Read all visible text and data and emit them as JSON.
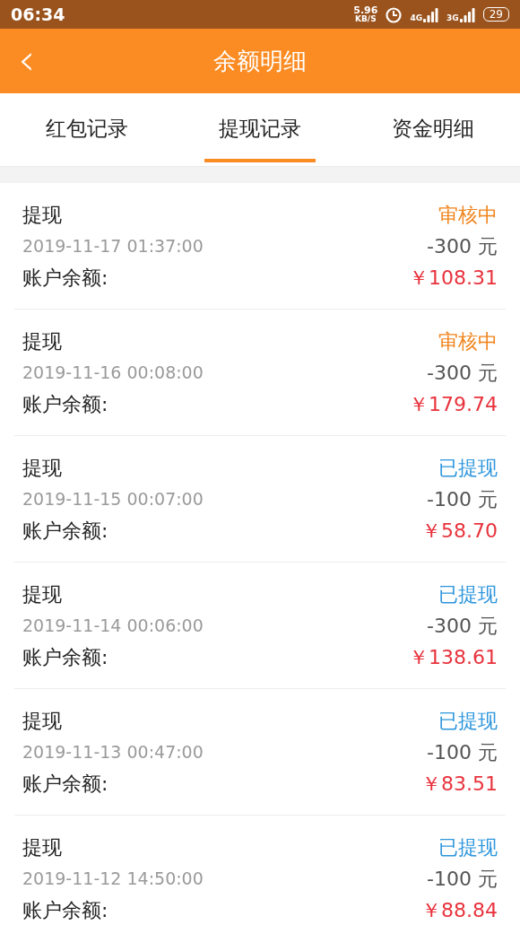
{
  "status_bar": {
    "time": "06:34",
    "speed": "5.96",
    "speed_unit": "KB/S",
    "network_1": "4G",
    "network_2": "3G",
    "battery": "29"
  },
  "header": {
    "back": "‹",
    "title": "余额明细"
  },
  "tabs": [
    {
      "label": "红包记录",
      "selected": false
    },
    {
      "label": "提现记录",
      "selected": true
    },
    {
      "label": "资金明细",
      "selected": false
    }
  ],
  "records": [
    {
      "title": "提现",
      "date": "2019-11-17 01:37:00",
      "balance_label": "账户余额:",
      "status": "审核中",
      "kind": "pending",
      "amount": "-300 元",
      "balance": "￥108.31"
    },
    {
      "title": "提现",
      "date": "2019-11-16 00:08:00",
      "balance_label": "账户余额:",
      "status": "审核中",
      "kind": "pending",
      "amount": "-300 元",
      "balance": "￥179.74"
    },
    {
      "title": "提现",
      "date": "2019-11-15 00:07:00",
      "balance_label": "账户余额:",
      "status": "已提现",
      "kind": "done",
      "amount": "-100 元",
      "balance": "￥58.70"
    },
    {
      "title": "提现",
      "date": "2019-11-14 00:06:00",
      "balance_label": "账户余额:",
      "status": "已提现",
      "kind": "done",
      "amount": "-300 元",
      "balance": "￥138.61"
    },
    {
      "title": "提现",
      "date": "2019-11-13 00:47:00",
      "balance_label": "账户余额:",
      "status": "已提现",
      "kind": "done",
      "amount": "-100 元",
      "balance": "￥83.51"
    },
    {
      "title": "提现",
      "date": "2019-11-12 14:50:00",
      "balance_label": "账户余额:",
      "status": "已提现",
      "kind": "done",
      "amount": "-100 元",
      "balance": "￥88.84"
    }
  ]
}
